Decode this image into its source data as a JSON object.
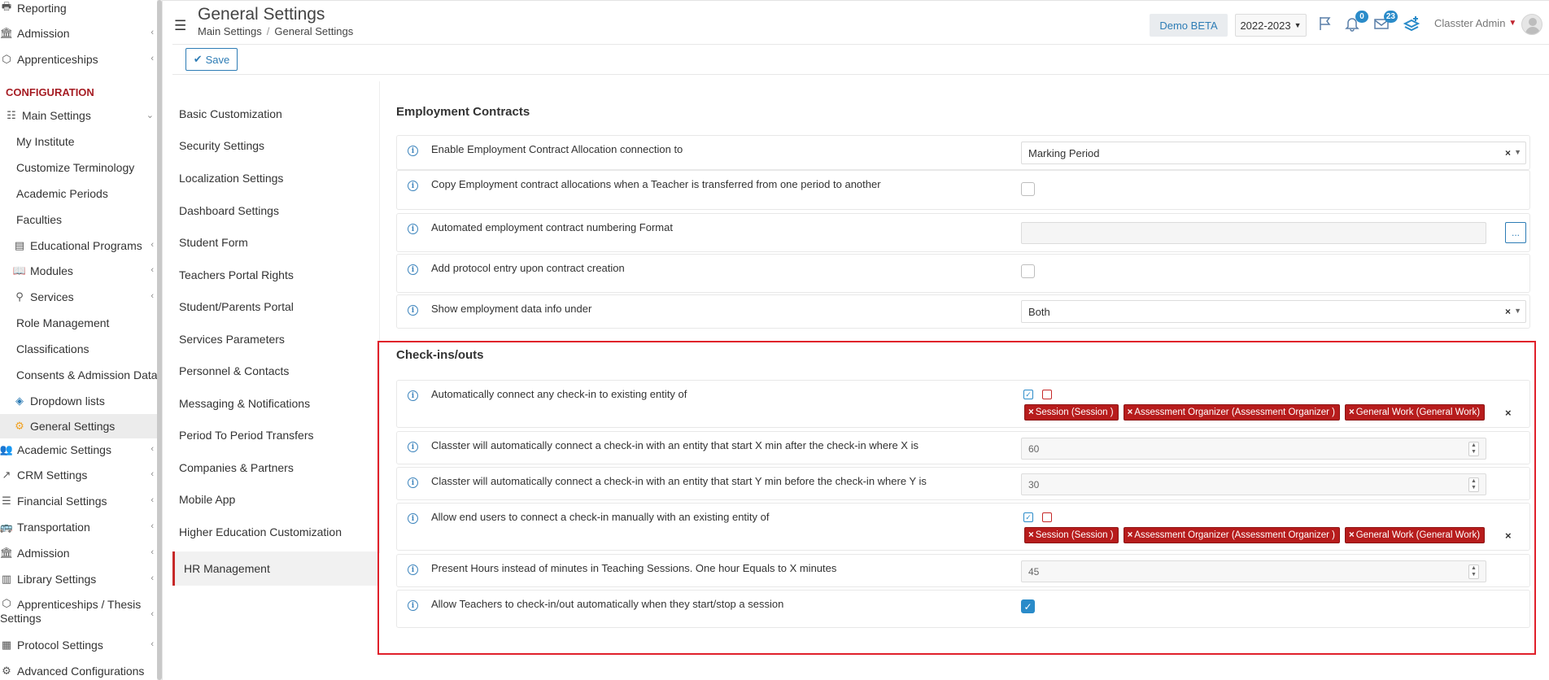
{
  "sidebar": {
    "items": [
      {
        "label": "Reporting",
        "icon": "printer-icon"
      },
      {
        "label": "Admission",
        "icon": "institution-icon"
      },
      {
        "label": "Apprenticeships",
        "icon": "cube-icon"
      },
      {
        "label": "Main Settings",
        "icon": "sliders-icon"
      },
      {
        "label": "My Institute"
      },
      {
        "label": "Customize Terminology"
      },
      {
        "label": "Academic Periods"
      },
      {
        "label": "Faculties"
      },
      {
        "label": "Educational Programs",
        "icon": "table-icon"
      },
      {
        "label": "Modules",
        "icon": "book-icon"
      },
      {
        "label": "Services",
        "icon": "services-icon"
      },
      {
        "label": "Role Management"
      },
      {
        "label": "Classifications"
      },
      {
        "label": "Consents & Admission Data"
      },
      {
        "label": "Dropdown lists",
        "icon": "layers-icon"
      },
      {
        "label": "General Settings",
        "icon": "gear-icon"
      },
      {
        "label": "Academic Settings",
        "icon": "users-icon"
      },
      {
        "label": "CRM Settings",
        "icon": "chart-icon"
      },
      {
        "label": "Financial Settings",
        "icon": "coins-icon"
      },
      {
        "label": "Transportation",
        "icon": "bus-icon"
      },
      {
        "label": "Admission",
        "icon": "institution-icon"
      },
      {
        "label": "Library Settings",
        "icon": "library-icon"
      },
      {
        "label": "Apprenticeships / Thesis",
        "label2": "Settings",
        "icon": "cube-icon"
      },
      {
        "label": "Protocol Settings",
        "icon": "protocol-icon"
      },
      {
        "label": "Advanced Configurations",
        "icon": "gears-icon"
      }
    ],
    "section_header": "CONFIGURATION"
  },
  "header": {
    "title": "General Settings",
    "breadcrumb": [
      "Main Settings",
      "General Settings"
    ],
    "breadcrumb_sep": "/",
    "demo_label": "Demo BETA",
    "year_label": "2022-2023",
    "notifications_count": "0",
    "messages_count": "23",
    "user_name": "Classter Admin"
  },
  "toolbar": {
    "save_label": "Save"
  },
  "settings_nav": {
    "items": [
      "Basic Customization",
      "Security Settings",
      "Localization Settings",
      "Dashboard Settings",
      "Student Form",
      "Teachers Portal Rights",
      "Student/Parents Portal",
      "Services Parameters",
      "Personnel & Contacts",
      "Messaging & Notifications",
      "Period To Period Transfers",
      "Companies & Partners",
      "Mobile App",
      "Higher Education Customization",
      "HR Management"
    ],
    "active": "HR Management"
  },
  "employment": {
    "title": "Employment Contracts",
    "rows": [
      {
        "label": "Enable Employment Contract Allocation connection to",
        "value": "Marking Period"
      },
      {
        "label": "Copy Employment contract allocations when a Teacher is transferred from one period to another",
        "checked": false
      },
      {
        "label": "Automated employment contract numbering Format",
        "value": "",
        "button": "..."
      },
      {
        "label": "Add protocol entry upon contract creation",
        "checked": false
      },
      {
        "label": "Show employment data info under",
        "value": "Both"
      }
    ]
  },
  "checkins": {
    "title": "Check-ins/outs",
    "rows": [
      {
        "label": "Automatically connect any check-in to existing entity of",
        "tags": [
          "Session (Session )",
          "Assessment Organizer (Assessment Organizer )",
          "General Work (General Work)"
        ]
      },
      {
        "label": "Classter will automatically connect a check-in with an entity that start X min after the check-in where X is",
        "value": "60"
      },
      {
        "label": "Classter will automatically connect a check-in with an entity that start Y min before the check-in where Y is",
        "value": "30"
      },
      {
        "label": "Allow end users to connect a check-in manually with an existing entity of",
        "tags": [
          "Session (Session )",
          "Assessment Organizer (Assessment Organizer )",
          "General Work (General Work)"
        ]
      },
      {
        "label": "Present Hours instead of minutes in Teaching Sessions. One hour Equals to X minutes",
        "value": "45"
      },
      {
        "label": "Allow Teachers to check-in/out automatically when they start/stop a session",
        "checked": true
      }
    ]
  },
  "colors": {
    "accent": "#2d7cb5",
    "tag": "#b71c1c",
    "highlight": "#e0202a",
    "config_header": "#a61d24"
  }
}
